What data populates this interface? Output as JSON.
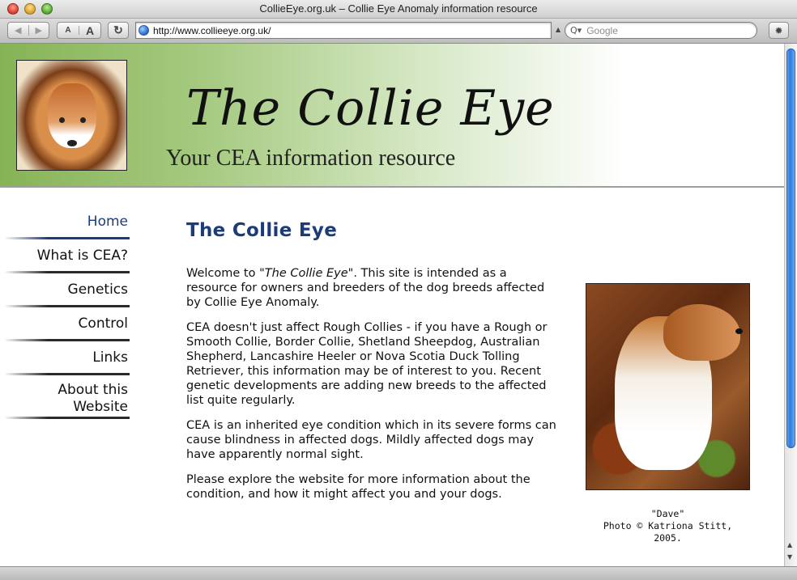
{
  "window": {
    "title": "CollieEye.org.uk – Collie Eye Anomaly information resource"
  },
  "toolbar": {
    "back_glyph": "◀",
    "forward_glyph": "▶",
    "text_small": "A",
    "text_large": "A",
    "reload_glyph": "↻",
    "url": "http://www.collieeye.org.uk/",
    "search_placeholder": "Google",
    "search_glyph": "Q▾",
    "bug_glyph": "✹"
  },
  "header": {
    "title": "The Collie Eye",
    "subtitle": "Your CEA information resource"
  },
  "nav": {
    "items": [
      {
        "label": "Home",
        "active": true
      },
      {
        "label": "What is CEA?"
      },
      {
        "label": "Genetics"
      },
      {
        "label": "Control"
      },
      {
        "label": "Links"
      },
      {
        "label": "About this",
        "label2": "Website"
      }
    ]
  },
  "main": {
    "heading": "The Collie Eye",
    "p1_pre": "Welcome to ",
    "p1_em": "\"The Collie Eye\"",
    "p1_post": ". This site is intended as a resource for owners and breeders of the dog breeds affected by Collie Eye Anomaly.",
    "p2": "CEA doesn't just affect Rough Collies - if you have a Rough or Smooth Collie, Border Collie, Shetland Sheepdog, Australian Shepherd, Lancashire Heeler or Nova Scotia Duck Tolling Retriever, this information may be of interest to you. Recent genetic developments are adding new breeds to the affected list quite regularly.",
    "p3": "CEA is an inherited eye condition which in its severe forms can cause blindness in affected dogs. Mildly affected dogs may have apparently normal sight.",
    "p4": "Please explore the website for more information about the condition, and how it might affect you and your dogs."
  },
  "photo": {
    "caption_1": "\"Dave\"",
    "caption_2": "Photo © Katriona Stitt,",
    "caption_3": "2005."
  },
  "colors": {
    "heading": "#1c3c78",
    "header_green": "#86b356"
  }
}
